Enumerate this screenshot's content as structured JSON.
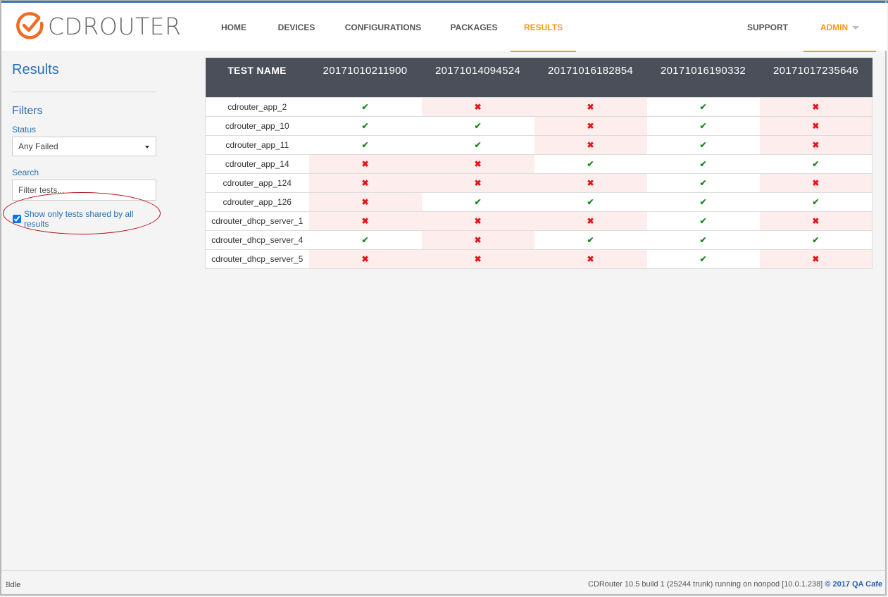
{
  "brand": {
    "name": "CDROUTER",
    "accent": "#f39a1e",
    "logo_color": "#ef6c22"
  },
  "nav": {
    "items": [
      {
        "label": "HOME",
        "active": false
      },
      {
        "label": "DEVICES",
        "active": false
      },
      {
        "label": "CONFIGURATIONS",
        "active": false
      },
      {
        "label": "PACKAGES",
        "active": false
      },
      {
        "label": "RESULTS",
        "active": true
      }
    ],
    "support": "SUPPORT",
    "admin": "ADMIN"
  },
  "sidebar": {
    "title": "Results",
    "filters_heading": "Filters",
    "status_label": "Status",
    "status_value": "Any Failed",
    "search_label": "Search",
    "search_placeholder": "Filter tests...",
    "shared_checkbox_label": "Show only tests shared by all results",
    "shared_checked": true
  },
  "table": {
    "name_header": "TEST NAME",
    "runs": [
      "20171010211900",
      "20171014094524",
      "20171016182854",
      "20171016190332",
      "20171017235646"
    ],
    "rows": [
      {
        "name": "cdrouter_app_2",
        "results": [
          "pass",
          "fail",
          "fail",
          "pass",
          "fail"
        ]
      },
      {
        "name": "cdrouter_app_10",
        "results": [
          "pass",
          "pass",
          "fail",
          "pass",
          "fail"
        ]
      },
      {
        "name": "cdrouter_app_11",
        "results": [
          "pass",
          "pass",
          "fail",
          "pass",
          "fail"
        ]
      },
      {
        "name": "cdrouter_app_14",
        "results": [
          "fail",
          "fail",
          "pass",
          "pass",
          "pass"
        ]
      },
      {
        "name": "cdrouter_app_124",
        "results": [
          "fail",
          "fail",
          "fail",
          "pass",
          "fail"
        ]
      },
      {
        "name": "cdrouter_app_126",
        "results": [
          "fail",
          "pass",
          "pass",
          "pass",
          "pass"
        ]
      },
      {
        "name": "cdrouter_dhcp_server_1",
        "results": [
          "fail",
          "fail",
          "fail",
          "pass",
          "fail"
        ]
      },
      {
        "name": "cdrouter_dhcp_server_4",
        "results": [
          "pass",
          "fail",
          "pass",
          "pass",
          "pass"
        ]
      },
      {
        "name": "cdrouter_dhcp_server_5",
        "results": [
          "fail",
          "fail",
          "fail",
          "pass",
          "fail"
        ]
      }
    ],
    "icons": {
      "pass": "✔",
      "fail": "✖"
    }
  },
  "footer": {
    "status": "Idle",
    "version": "CDRouter 10.5 build 1 (25244 trunk) running on nonpod [10.0.1.238]",
    "copyright": "© 2017 QA Cafe"
  }
}
